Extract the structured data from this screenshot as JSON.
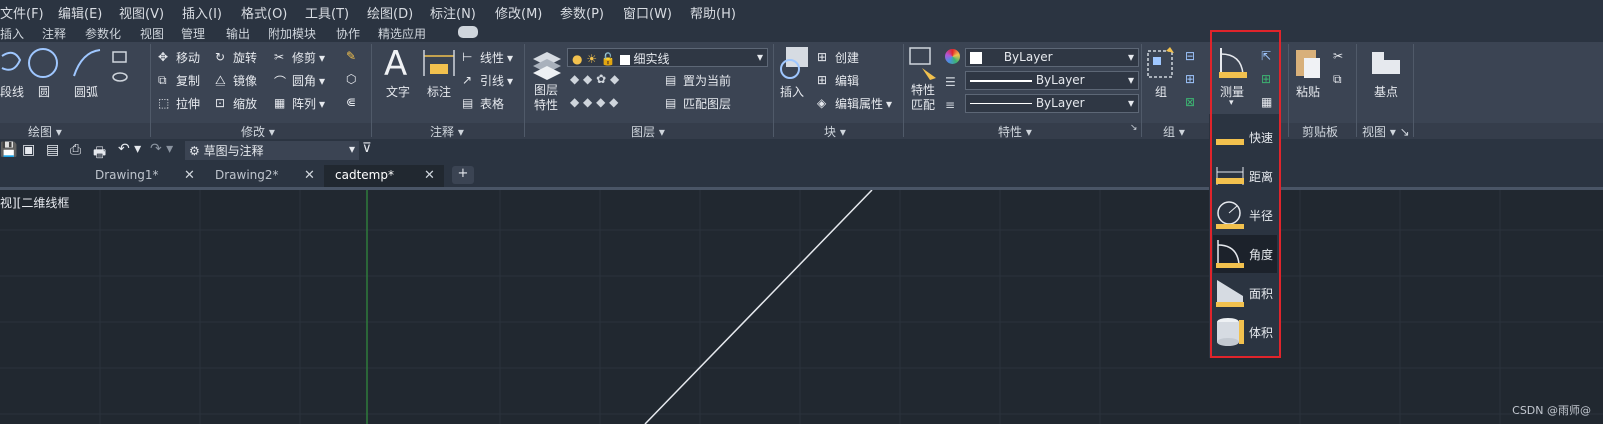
{
  "menu": [
    "文件(F)",
    "编辑(E)",
    "视图(V)",
    "插入(I)",
    "格式(O)",
    "工具(T)",
    "绘图(D)",
    "标注(N)",
    "修改(M)",
    "参数(P)",
    "窗口(W)",
    "帮助(H)"
  ],
  "ribbon_tabs": [
    "插入",
    "注释",
    "参数化",
    "视图",
    "管理",
    "输出",
    "附加模块",
    "协作",
    "精选应用"
  ],
  "draw_panel": {
    "title": "绘图",
    "tools": [
      "段线",
      "圆",
      "圆弧"
    ]
  },
  "modify_panel": {
    "title": "修改",
    "tools": [
      "移动",
      "旋转",
      "修剪",
      "复制",
      "镜像",
      "圆角",
      "拉伸",
      "缩放",
      "阵列"
    ]
  },
  "annotation_panel": {
    "title": "注释",
    "big": [
      "文字",
      "标注"
    ],
    "tools": [
      "线性",
      "引线",
      "表格"
    ]
  },
  "layer_panel": {
    "title": "图层",
    "big": "图层\n特性",
    "layer_name": "细实线",
    "tools": [
      "置为当前",
      "匹配图层"
    ]
  },
  "block_panel": {
    "title": "块",
    "big": "插入",
    "tools": [
      "创建",
      "编辑",
      "编辑属性"
    ]
  },
  "properties_panel": {
    "title": "特性",
    "big": "特性\n匹配",
    "color": "ByLayer",
    "linetype": "ByLayer",
    "lineweight": "ByLayer"
  },
  "group_panel": {
    "title": "组",
    "big": "组"
  },
  "utilities": {
    "big": "测量"
  },
  "clipboard_panel": {
    "title": "剪贴板",
    "big": "粘贴"
  },
  "view_panel": {
    "title": "视图",
    "big": "基点"
  },
  "qat": {
    "workspace": "草图与注释"
  },
  "doc_tabs": [
    {
      "label": "Drawing1*",
      "active": false
    },
    {
      "label": "Drawing2*",
      "active": false
    },
    {
      "label": "cadtemp*",
      "active": true
    }
  ],
  "viewport_label": "俯视][二维线框]",
  "viewport_label_visible": "视][二维线框",
  "measure_flyout": [
    "快速",
    "距离",
    "半径",
    "角度",
    "面积",
    "体积"
  ],
  "selected_measure": "角度",
  "watermark": "CSDN @雨师@",
  "colors": {
    "highlight": "#e0242b",
    "canvas": "#212830",
    "ribbon": "#3b4453"
  }
}
